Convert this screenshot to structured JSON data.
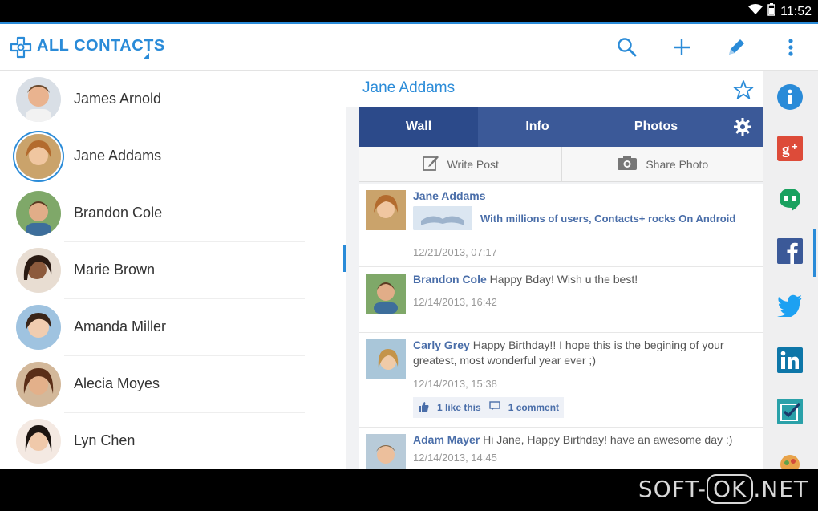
{
  "status_bar": {
    "time": "11:52"
  },
  "action_bar": {
    "title": "ALL CONTACTS"
  },
  "contacts": [
    {
      "name": "James Arnold"
    },
    {
      "name": "Jane Addams"
    },
    {
      "name": "Brandon Cole"
    },
    {
      "name": "Marie Brown"
    },
    {
      "name": "Amanda Miller"
    },
    {
      "name": "Alecia Moyes"
    },
    {
      "name": "Lyn Chen"
    }
  ],
  "detail": {
    "name": "Jane Addams",
    "tabs": [
      {
        "label": "Wall"
      },
      {
        "label": "Info"
      },
      {
        "label": "Photos"
      }
    ],
    "actions": {
      "write_post": "Write Post",
      "share_photo": "Share Photo"
    },
    "posts": [
      {
        "author": "Jane Addams",
        "text": "",
        "shared": "With millions of users, Contacts+ rocks On Android",
        "date": "12/21/2013, 07:17"
      },
      {
        "author": "Brandon Cole",
        "text": " Happy Bday! Wish u the best!",
        "date": "12/14/2013, 16:42"
      },
      {
        "author": "Carly Grey",
        "text": " Happy Birthday!! I hope this is the begining of your greatest, most wonderful year ever ;)",
        "date": "12/14/2013, 15:38",
        "likes": "1 like this",
        "comments": "1 comment"
      },
      {
        "author": "Adam Mayer",
        "text": " Hi Jane, Happy Birthday! have an awesome day :)",
        "date": "12/14/2013, 14:45"
      }
    ]
  },
  "rail": {
    "icons": [
      "info-icon",
      "google-plus-icon",
      "hangouts-icon",
      "facebook-icon",
      "twitter-icon",
      "linkedin-icon",
      "tasks-icon",
      "more-icon"
    ]
  },
  "watermark": {
    "left": "SOFT-",
    "ok": "OK",
    "right": ".NET"
  },
  "colors": {
    "accent": "#2a8bd8",
    "facebook": "#3b5998"
  }
}
